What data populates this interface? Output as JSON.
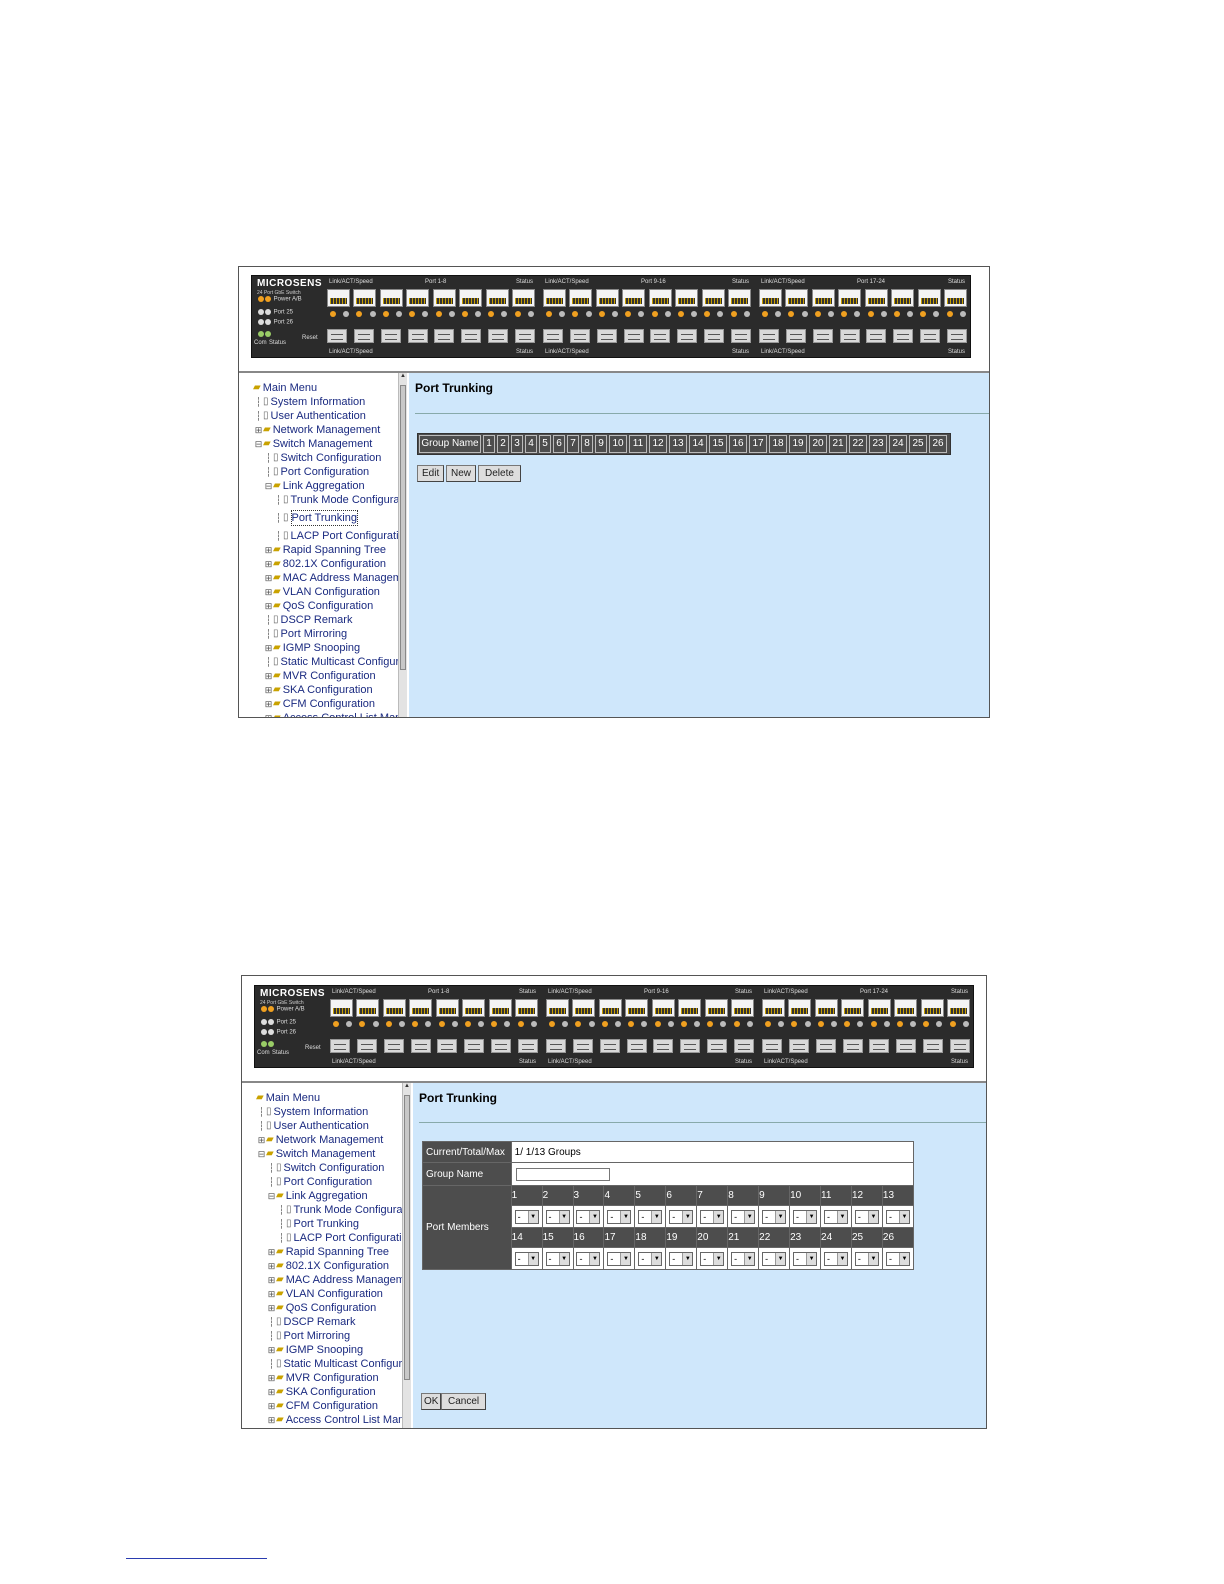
{
  "panel": {
    "brand": "MICROSENS",
    "subtitle": "24 Port GbE Switch",
    "power": "Power A/B",
    "port25": "Port 25",
    "port26": "Port 26",
    "com": "Com",
    "status": "Status",
    "reset": "Reset",
    "groups": [
      {
        "range": "Port 1-8",
        "link": "Link/ACT/Speed",
        "status": "Status"
      },
      {
        "range": "Port 9-16",
        "link": "Link/ACT/Speed",
        "status": "Status"
      },
      {
        "range": "Port 17-24",
        "link": "Link/ACT/Speed",
        "status": "Status"
      }
    ]
  },
  "menu": [
    {
      "label": "Main Menu",
      "kind": "folder-open",
      "level": 0,
      "exp": ""
    },
    {
      "label": "System Information",
      "kind": "doc",
      "level": 1,
      "exp": ""
    },
    {
      "label": "User Authentication",
      "kind": "doc",
      "level": 1,
      "exp": ""
    },
    {
      "label": "Network Management",
      "kind": "folder",
      "level": 1,
      "exp": "+"
    },
    {
      "label": "Switch Management",
      "kind": "folder-open",
      "level": 1,
      "exp": "-"
    },
    {
      "label": "Switch Configuration",
      "kind": "doc",
      "level": 2,
      "exp": ""
    },
    {
      "label": "Port Configuration",
      "kind": "doc",
      "level": 2,
      "exp": ""
    },
    {
      "label": "Link Aggregation",
      "kind": "folder-open",
      "level": 2,
      "exp": "-"
    },
    {
      "label": "Trunk Mode Configuratior",
      "kind": "doc",
      "level": 3,
      "exp": ""
    },
    {
      "label": "Port Trunking",
      "kind": "doc",
      "level": 3,
      "exp": ""
    },
    {
      "label": "LACP Port Configuration",
      "kind": "doc",
      "level": 3,
      "exp": ""
    },
    {
      "label": "Rapid Spanning Tree",
      "kind": "folder",
      "level": 2,
      "exp": "+"
    },
    {
      "label": "802.1X Configuration",
      "kind": "folder",
      "level": 2,
      "exp": "+"
    },
    {
      "label": "MAC Address Managemen",
      "kind": "folder",
      "level": 2,
      "exp": "+"
    },
    {
      "label": "VLAN Configuration",
      "kind": "folder",
      "level": 2,
      "exp": "+"
    },
    {
      "label": "QoS Configuration",
      "kind": "folder",
      "level": 2,
      "exp": "+"
    },
    {
      "label": "DSCP Remark",
      "kind": "doc",
      "level": 2,
      "exp": ""
    },
    {
      "label": "Port Mirroring",
      "kind": "doc",
      "level": 2,
      "exp": ""
    },
    {
      "label": "IGMP Snooping",
      "kind": "folder",
      "level": 2,
      "exp": "+"
    },
    {
      "label": "Static Multicast Configuratic",
      "kind": "doc",
      "level": 2,
      "exp": ""
    },
    {
      "label": "MVR Configuration",
      "kind": "folder",
      "level": 2,
      "exp": "+"
    },
    {
      "label": "SKA Configuration",
      "kind": "folder",
      "level": 2,
      "exp": "+"
    },
    {
      "label": "CFM Configuration",
      "kind": "folder",
      "level": 2,
      "exp": "+"
    },
    {
      "label": "Access Control List Manage",
      "kind": "folder",
      "level": 2,
      "exp": "+"
    }
  ],
  "screen1": {
    "title": "Port Trunking",
    "header": [
      "Group Name",
      "1",
      "2",
      "3",
      "4",
      "5",
      "6",
      "7",
      "8",
      "9",
      "10",
      "11",
      "12",
      "13",
      "14",
      "15",
      "16",
      "17",
      "18",
      "19",
      "20",
      "21",
      "22",
      "23",
      "24",
      "25",
      "26"
    ],
    "edit": "Edit",
    "new": "New",
    "delete": "Delete",
    "selected_menu": "Port Trunking"
  },
  "screen2": {
    "title": "Port Trunking",
    "current_label": "Current/Total/Max",
    "current_value": "1/ 1/13 Groups",
    "group_name_label": "Group Name",
    "group_name_value": "",
    "members_label": "Port Members",
    "ports_row1": [
      "1",
      "2",
      "3",
      "4",
      "5",
      "6",
      "7",
      "8",
      "9",
      "10",
      "11",
      "12",
      "13"
    ],
    "ports_row2": [
      "14",
      "15",
      "16",
      "17",
      "18",
      "19",
      "20",
      "21",
      "22",
      "23",
      "24",
      "25",
      "26"
    ],
    "member_value": "-",
    "ok": "OK",
    "cancel": "Cancel"
  }
}
